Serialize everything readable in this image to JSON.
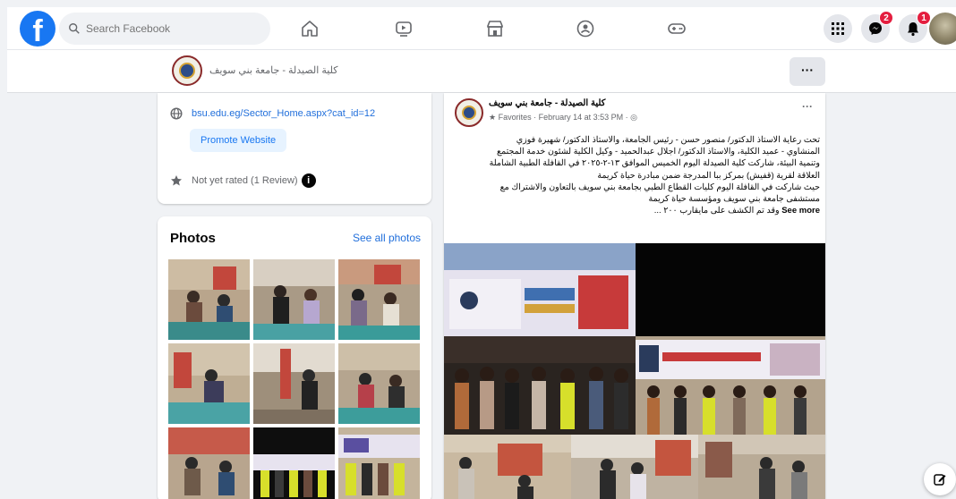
{
  "topbar": {
    "logo": "f",
    "search_placeholder": "Search Facebook",
    "nav_icons": [
      "home-icon",
      "watch-icon",
      "marketplace-icon",
      "groups-icon",
      "gaming-icon"
    ],
    "messenger_badge": "2",
    "notifications_badge": "1"
  },
  "page": {
    "name": "كلية الصيدلة - جامعة بني سويف",
    "more": "···"
  },
  "intro": {
    "website": "bsu.edu.eg/Sector_Home.aspx?cat_id=12",
    "promote_label": "Promote Website",
    "rating": "Not yet rated (1 Review)",
    "info_glyph": "i"
  },
  "photos": {
    "title": "Photos",
    "see_all": "See all photos"
  },
  "post": {
    "author": "كلية الصيدلة - جامعة بني سويف",
    "meta": "★ Favorites · February 14 at 3:53 PM · ◎",
    "more": "···",
    "text_lines": [
      "تحت رعاية الاستاذ الدكتور/ منصور حسن - رئيس الجامعة، والاستاذ الدكتور/ شهيرة فوزي",
      "المنشاوي - عميد الكلية، والاستاذ الدكتور/ اجلال عبدالحميد - وكيل الكلية لشئون خدمة المجتمع",
      "وتنمية البيئة، شاركت كلية الصيدلة اليوم الخميس الموافق ١٣-٢-٢٠٢٥ في القافلة الطبية الشاملة",
      "العلاقة لقرية (قفيش) بمركز ببا المدرجة ضمن مبادرة حياة كريمة",
      "حيث شاركت في القافلة اليوم كليات القطاع الطبي بجامعة بني سويف بالتعاون والاشتراك مع",
      "مستشفى جامعة بني سويف ومؤسسة حياة كريمة",
      "وقد تم الكشف على مايقارب ٢٠٠ ..."
    ],
    "see_more": "See more"
  },
  "colors": {
    "brand": "#1877f2",
    "link": "#216fdb",
    "badge": "#e41e3f",
    "background": "#f0f2f5"
  }
}
